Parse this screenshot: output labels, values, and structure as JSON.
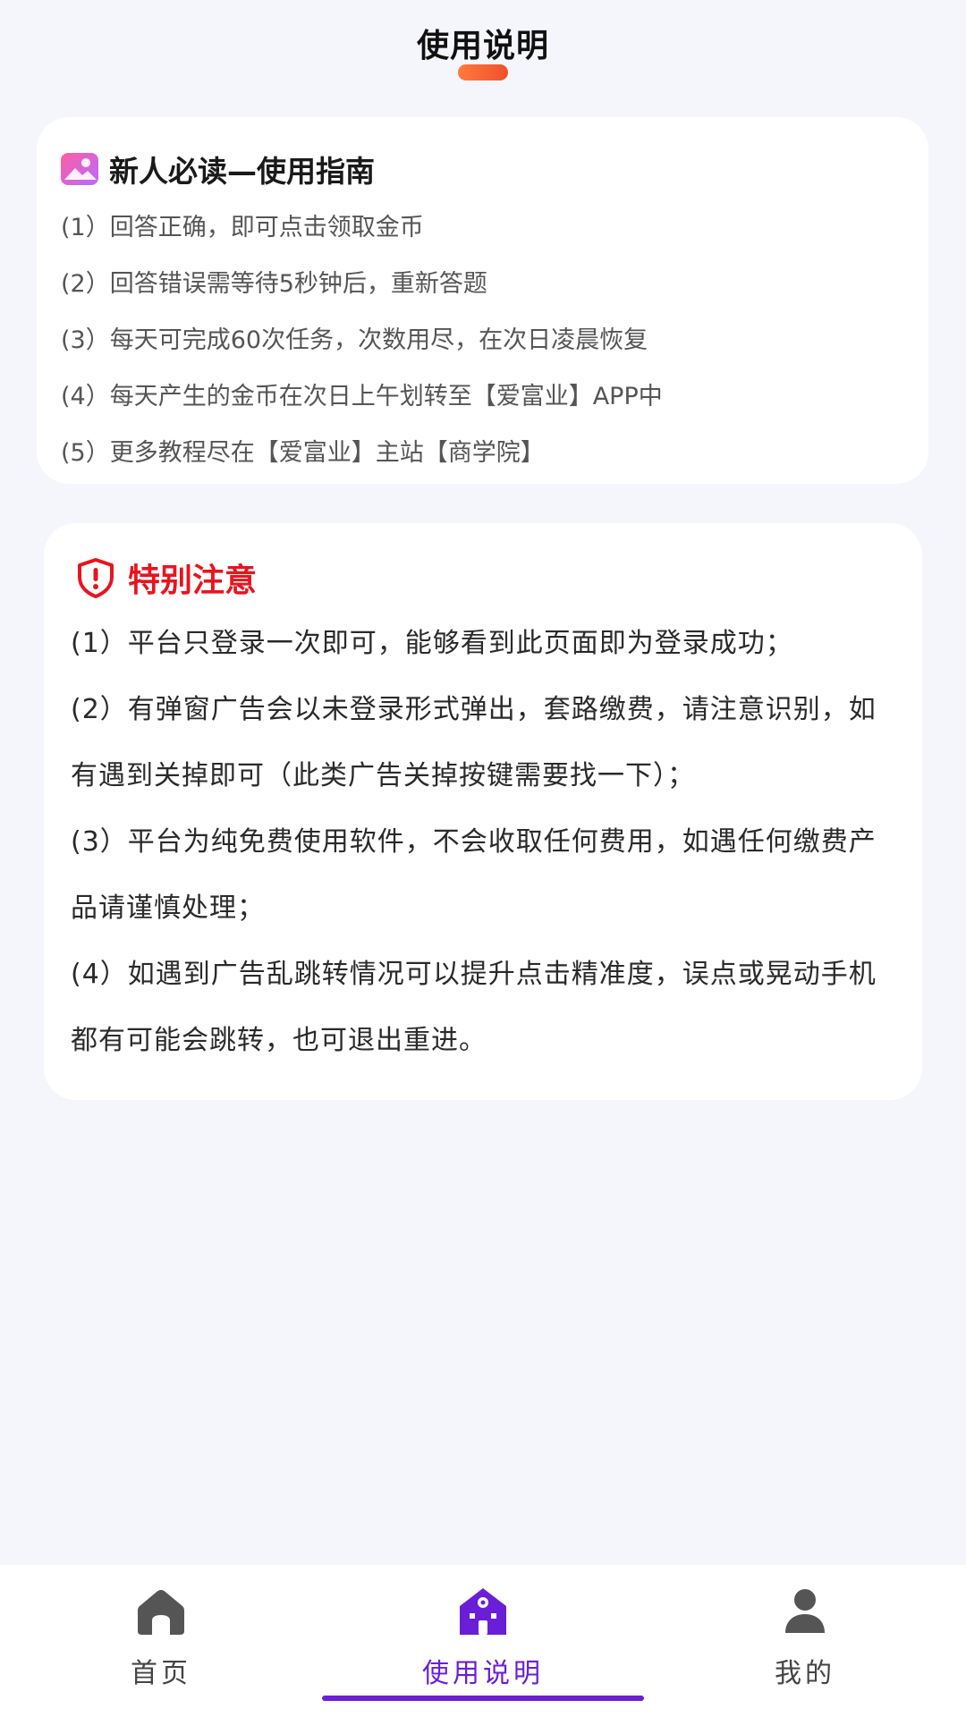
{
  "header": {
    "title": "使用说明",
    "accent_color": "#f0502c"
  },
  "guide": {
    "title": "新人必读—使用指南",
    "icon": "image-icon",
    "items": [
      "(1）回答正确，即可点击领取金币",
      "(2）回答错误需等待5秒钟后，重新答题",
      "(3）每天可完成60次任务，次数用尽，在次日凌晨恢复",
      "(4）每天产生的金币在次日上午划转至【爱富业】APP中",
      "(5）更多教程尽在【爱富业】主站【商学院】"
    ]
  },
  "notice": {
    "title": "特别注意",
    "icon": "shield-alert-icon",
    "title_color": "#e8141f",
    "items": [
      "(1）平台只登录一次即可，能够看到此页面即为登录成功；",
      "(2）有弹窗广告会以未登录形式弹出，套路缴费，请注意识别，如有遇到关掉即可（此类广告关掉按键需要找一下）；",
      "(3）平台为纯免费使用软件，不会收取任何费用，如遇任何缴费产品请谨慎处理；",
      "(4）如遇到广告乱跳转情况可以提升点击精准度，误点或晃动手机都有可能会跳转，也可退出重进。"
    ]
  },
  "bottom_nav": {
    "active_color": "#6a1ed8",
    "items": [
      {
        "label": "首页",
        "icon": "home-icon",
        "active": false
      },
      {
        "label": "使用说明",
        "icon": "guide-house-icon",
        "active": true
      },
      {
        "label": "我的",
        "icon": "user-icon",
        "active": false
      }
    ]
  }
}
